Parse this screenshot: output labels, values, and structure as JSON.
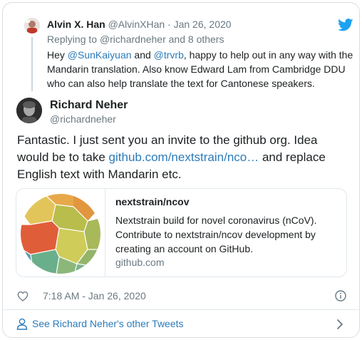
{
  "parent_tweet": {
    "author_name": "Alvin X. Han",
    "author_meta": "@AlvinXHan · Jan 26, 2020",
    "reply_to_prefix": "Replying to ",
    "reply_to_mention": "@richardneher",
    "reply_to_suffix": " and 8 others",
    "text_1": "Hey ",
    "mention_1": "@SunKaiyuan",
    "text_2": " and ",
    "mention_2": "@trvrb",
    "text_3": ", happy to help out in any way with the Mandarin translation. Also know Edward Lam from Cambridge DDU who can also help translate the text for Cantonese speakers."
  },
  "main_tweet": {
    "author_name": "Richard Neher",
    "author_handle": "@richardneher",
    "text_1": "Fantastic. I just sent you an invite to the github org. Idea would be to take ",
    "link": "github.com/nextstrain/nco…",
    "text_2": " and replace English text with Mandarin etc."
  },
  "link_card": {
    "title": "nextstrain/ncov",
    "description": "Nextstrain build for novel coronavirus (nCoV). Contribute to nextstrain/ncov development by creating an account on GitHub.",
    "domain": "github.com"
  },
  "footer": {
    "timestamp": "7:18 AM - Jan 26, 2020",
    "more_tweets_label": "See Richard Neher's other Tweets"
  },
  "colors": {
    "link_blue": "#2b7bb9",
    "twitter_blue": "#1da1f2",
    "secondary_text": "#697882"
  },
  "icons": [
    "twitter-bird-icon",
    "heart-icon",
    "info-icon",
    "person-icon",
    "chevron-right-icon"
  ]
}
